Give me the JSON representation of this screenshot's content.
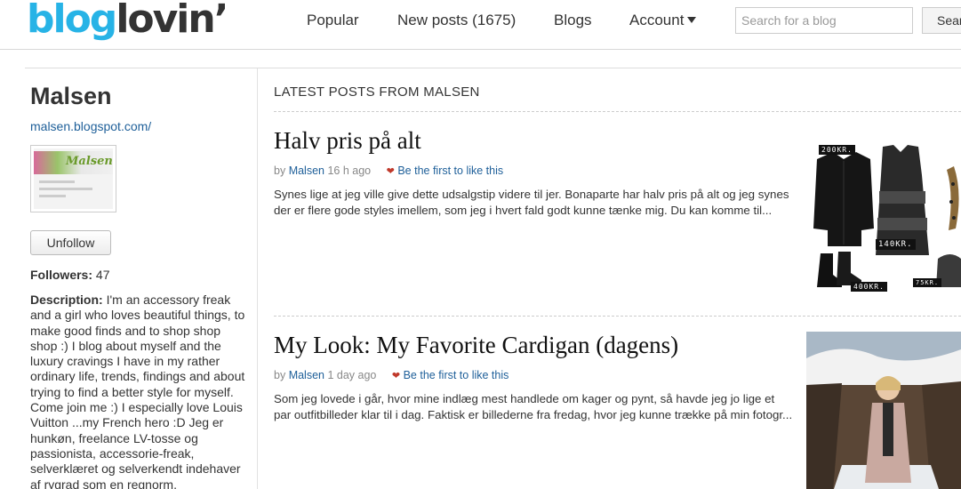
{
  "header": {
    "logo_part1": "blog",
    "logo_part2": "lovin’",
    "nav": {
      "popular": "Popular",
      "new_posts": "New posts (1675)",
      "blogs": "Blogs",
      "account": "Account"
    },
    "search": {
      "placeholder": "Search for a blog",
      "button_label": "Sear"
    }
  },
  "sidebar": {
    "blog_name": "Malsen",
    "blog_url": "malsen.blogspot.com/",
    "thumb_title": "Malsen",
    "unfollow_label": "Unfollow",
    "followers_label": "Followers:",
    "followers_count": "47",
    "description_label": "Description:",
    "description_text": " I'm an accessory freak and a girl who loves beautiful things, to make good finds and to shop shop shop :) I blog about myself and the luxury cravings I have in my rather ordinary life, trends, findings and about trying to find a better style for myself. Come join me :) I especially love Louis Vuitton ...my French hero :D Jeg er hunkøn, freelance LV-tosse og passionista, accessorie-freak, selverklæret og selverkendt indehaver af rygrad som en regnorm,"
  },
  "main": {
    "section_title": "LATEST POSTS FROM MALSEN",
    "posts": [
      {
        "title": "Halv pris på alt",
        "by": "by",
        "author": "Malsen",
        "time": "16 h ago",
        "like": "Be the first to like this",
        "excerpt": "Synes lige at jeg ville give dette udsalgstip videre til jer. Bonaparte har halv pris på alt og jeg synes der er flere gode styles imellem, som jeg i hvert fald godt kunne tænke mig. Du kan komme til...",
        "price_tags": [
          "200KR.",
          "140KR.",
          "400KR.",
          "75KR."
        ]
      },
      {
        "title": "My Look: My Favorite Cardigan (dagens)",
        "by": "by",
        "author": "Malsen",
        "time": "1 day ago",
        "like": "Be the first to like this",
        "excerpt": "Som jeg lovede i går, hvor mine indlæg mest handlede om kager og pynt, så havde jeg jo lige et par outfitbilleder klar til i dag. Faktisk er billederne fra fredag, hvor jeg kunne trække på min fotogr..."
      }
    ]
  },
  "colors": {
    "brand_blue": "#27b3e6",
    "link_blue": "#1e5f99",
    "heart_red": "#c0392b"
  }
}
